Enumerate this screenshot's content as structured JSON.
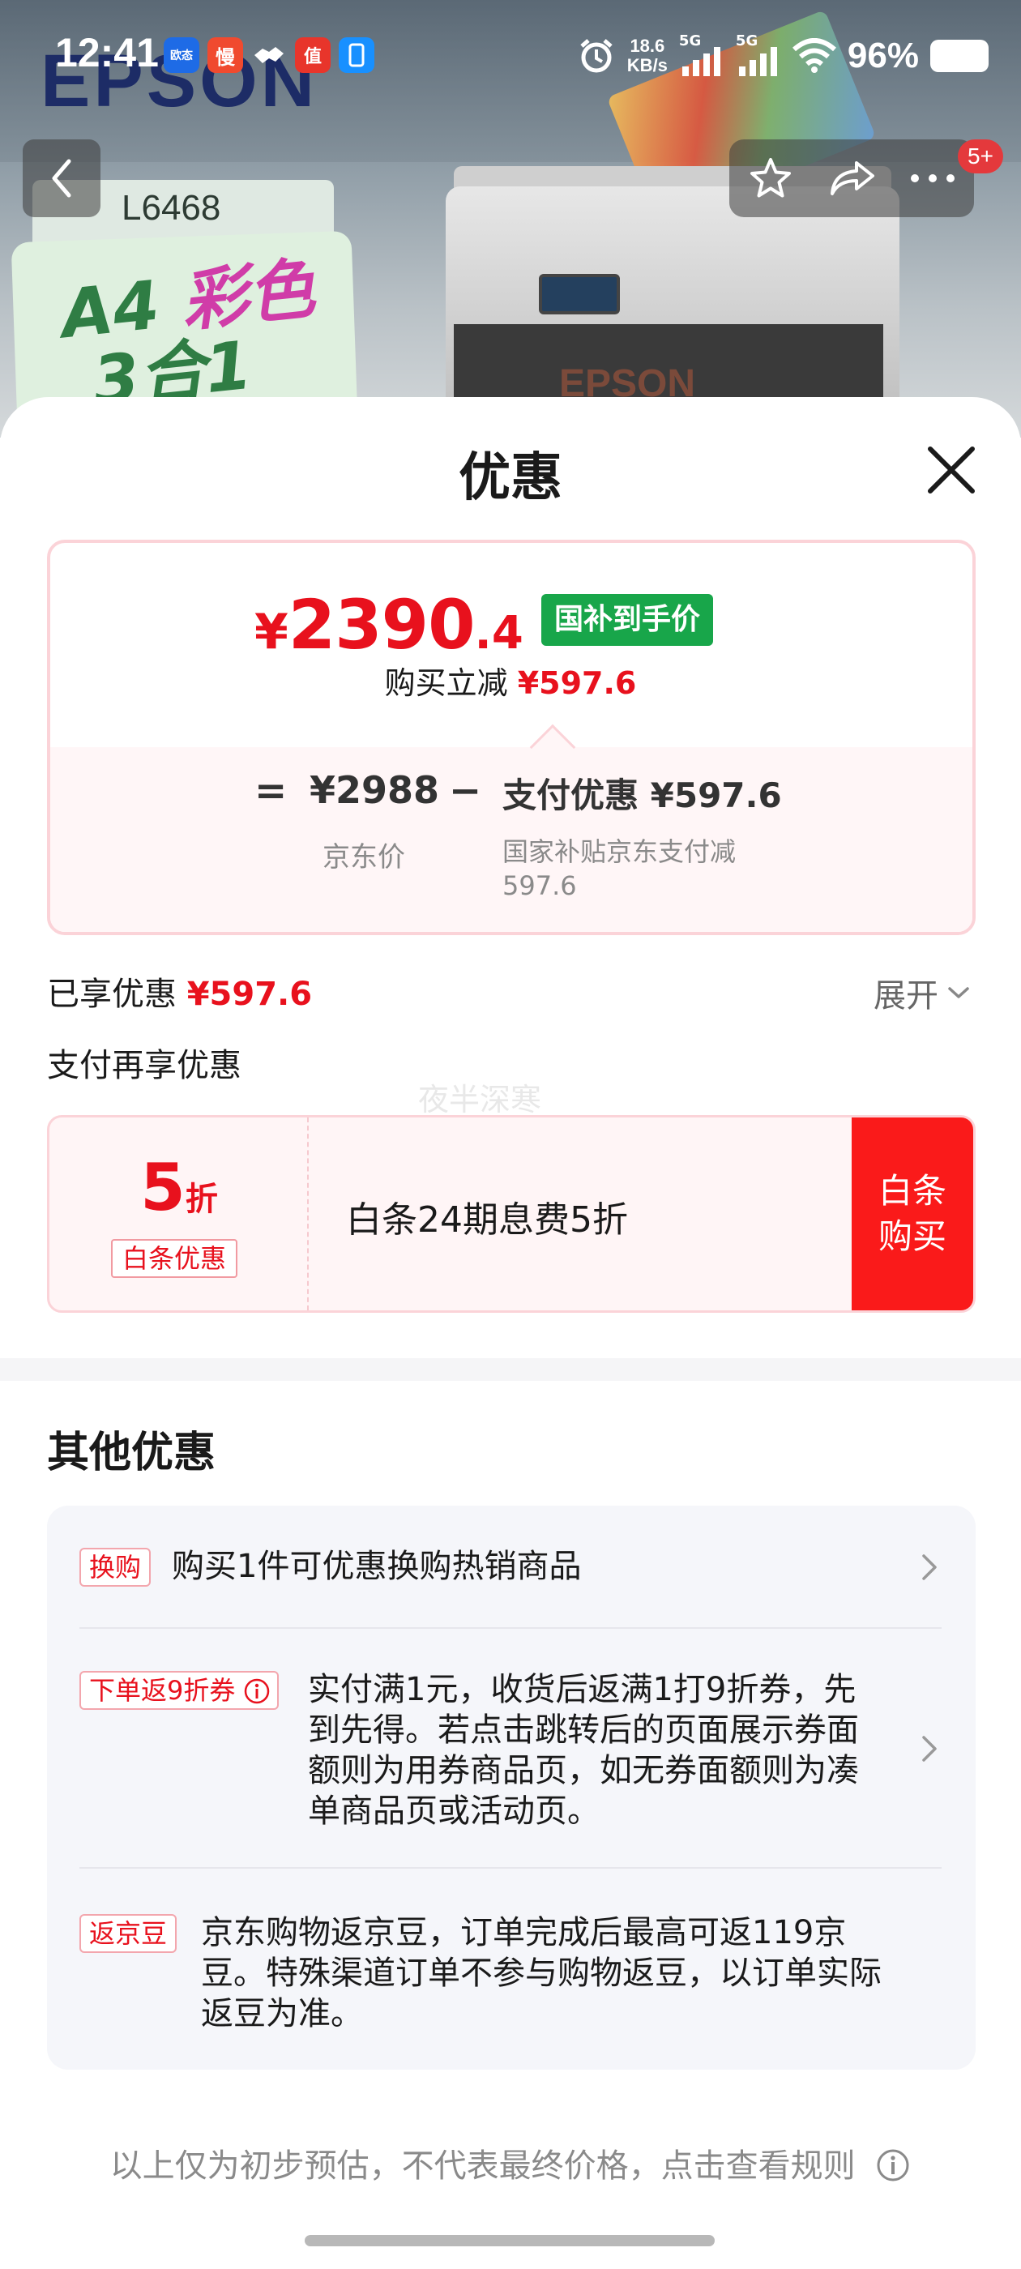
{
  "status_bar": {
    "time": "12:41",
    "app_icons": [
      {
        "name": "app-icon-1",
        "label": "欧态",
        "color": "#1e6be6"
      },
      {
        "name": "app-icon-2",
        "label": "慢",
        "color": "#f04a2f"
      },
      {
        "name": "app-icon-3",
        "label": "",
        "color": "#ffffff"
      },
      {
        "name": "app-icon-4",
        "label": "值",
        "color": "#e8352b"
      },
      {
        "name": "app-icon-5",
        "label": "",
        "color": "#1890ff"
      }
    ],
    "net_speed_value": "18.6",
    "net_speed_unit": "KB/s",
    "sim1": "5G",
    "sim2": "5G",
    "battery_pct": "96%"
  },
  "hero": {
    "brand": "EPSON",
    "model": "L6468",
    "promo_line1_a": "A4 ",
    "promo_line1_b": "彩色",
    "promo_line2": "3合1",
    "printer_label": "EPSON"
  },
  "nav": {
    "cart_badge": "5+"
  },
  "sheet": {
    "title": "优惠"
  },
  "price": {
    "yen": "¥",
    "final_int": "2390",
    "final_dec": ".4",
    "tag": "国补到手价",
    "saving_label": "购买立减",
    "saving_value": "¥597.6",
    "eq": "=",
    "jd_price": "¥2988",
    "jd_price_label": "京东价",
    "minus": "−",
    "pay_discount": "支付优惠 ¥597.6",
    "pay_discount_desc": "国家补贴京东支付减597.6"
  },
  "enjoyed": {
    "label": "已享优惠",
    "value": "¥597.6",
    "expand": "展开"
  },
  "pay_more": {
    "title": "支付再享优惠",
    "watermark": "夜半深寒"
  },
  "baitiao": {
    "num": "5",
    "unit": "折",
    "label": "白条优惠",
    "desc": "白条24期息费5折",
    "buy_line1": "白条",
    "buy_line2": "购买"
  },
  "other": {
    "title": "其他优惠",
    "items": [
      {
        "tag": "换购",
        "text": "购买1件可优惠换购热销商品"
      },
      {
        "tag": "下单返9折券",
        "text": "实付满1元，收货后返满1打9折券，先到先得。若点击跳转后的页面展示券面额则为用券商品页，如无券面额则为凑单商品页或活动页。"
      },
      {
        "tag": "返京豆",
        "text": "京东购物返京豆，订单完成后最高可返119京豆。特殊渠道订单不参与购物返豆，以订单实际返豆为准。"
      }
    ]
  },
  "footer": {
    "note": "以上仅为初步预估，不代表最终价格，点击查看规则"
  },
  "colors": {
    "accent_red": "#e8111d",
    "subsidy_green": "#18a64a",
    "buy_red": "#fa1a1a"
  }
}
